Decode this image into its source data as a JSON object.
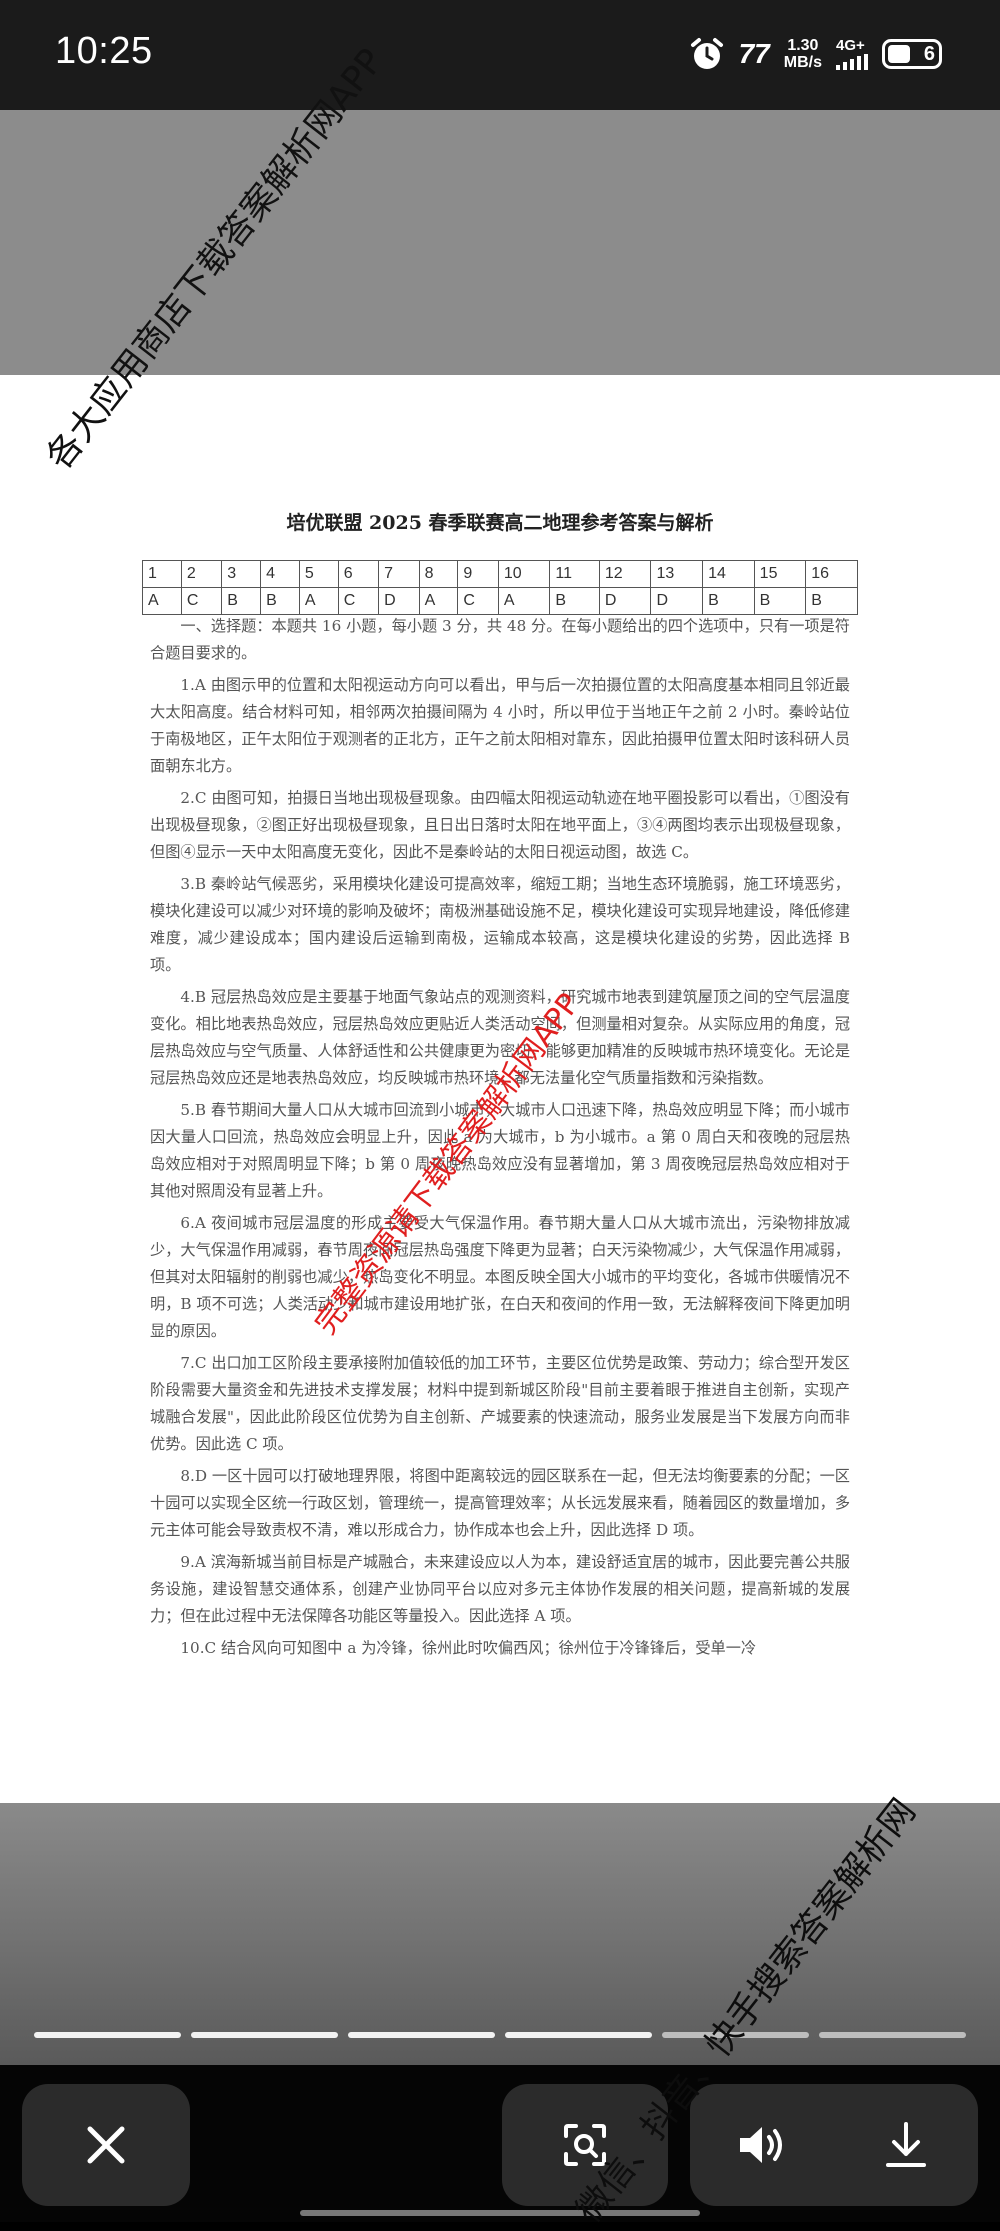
{
  "status_bar": {
    "time": "10:25",
    "hd_label": "77",
    "speed_value": "1.30",
    "speed_unit": "MB/s",
    "network": "4G+",
    "battery_level": "6"
  },
  "document": {
    "title": "培优联盟 2025 春季联赛高二地理参考答案与解析",
    "answer_table": {
      "numbers": [
        "1",
        "2",
        "3",
        "4",
        "5",
        "6",
        "7",
        "8",
        "9",
        "10",
        "11",
        "12",
        "13",
        "14",
        "15",
        "16"
      ],
      "answers": [
        "A",
        "C",
        "B",
        "B",
        "A",
        "C",
        "D",
        "A",
        "C",
        "A",
        "B",
        "D",
        "D",
        "B",
        "B",
        "B"
      ]
    },
    "paragraphs": [
      "一、选择题：本题共 16 小题，每小题 3 分，共 48 分。在每小题给出的四个选项中，只有一项是符合题目要求的。",
      "1.A 由图示甲的位置和太阳视运动方向可以看出，甲与后一次拍摄位置的太阳高度基本相同且邻近最大太阳高度。结合材料可知，相邻两次拍摄间隔为 4 小时，所以甲位于当地正午之前 2 小时。秦岭站位于南极地区，正午太阳位于观测者的正北方，正午之前太阳相对靠东，因此拍摄甲位置太阳时该科研人员面朝东北方。",
      "2.C 由图可知，拍摄日当地出现极昼现象。由四幅太阳视运动轨迹在地平圈投影可以看出，①图没有出现极昼现象，②图正好出现极昼现象，且日出日落时太阳在地平面上，③④两图均表示出现极昼现象，但图④显示一天中太阳高度无变化，因此不是秦岭站的太阳日视运动图，故选 C。",
      "3.B 秦岭站气候恶劣，采用模块化建设可提高效率，缩短工期；当地生态环境脆弱，施工环境恶劣，模块化建设可以减少对环境的影响及破坏；南极洲基础设施不足，模块化建设可实现异地建设，降低修建难度，减少建设成本；国内建设后运输到南极，运输成本较高，这是模块化建设的劣势，因此选择 B 项。",
      "4.B 冠层热岛效应是主要基于地面气象站点的观测资料，研究城市地表到建筑屋顶之间的空气层温度变化。相比地表热岛效应，冠层热岛效应更贴近人类活动空间，但测量相对复杂。从实际应用的角度，冠层热岛效应与空气质量、人体舒适性和公共健康更为密切，能够更加精准的反映城市热环境变化。无论是冠层热岛效应还是地表热岛效应，均反映城市热环境，都无法量化空气质量指数和污染指数。",
      "5.B 春节期间大量人口从大城市回流到小城市，大城市人口迅速下降，热岛效应明显下降；而小城市因大量人口回流，热岛效应会明显上升，因此 a 为大城市，b 为小城市。a 第 0 周白天和夜晚的冠层热岛效应相对于对照周明显下降；b 第 0 周夜晚热岛效应没有显著增加，第 3 周夜晚冠层热岛效应相对于其他对照周没有显著上升。",
      "6.A 夜间城市冠层温度的形成主要受大气保温作用。春节期大量人口从大城市流出，污染物排放减少，大气保温作用减弱，春节周夜间冠层热岛强度下降更为显著；白天污染物减少，大气保温作用减弱，但其对太阳辐射的削弱也减少，热岛变化不明显。本图反映全国大小城市的平均变化，各城市供暖情况不明，B 项不可选；人类活动少和城市建设用地扩张，在白天和夜间的作用一致，无法解释夜间下降更加明显的原因。",
      "7.C 出口加工区阶段主要承接附加值较低的加工环节，主要区位优势是政策、劳动力；综合型开发区阶段需要大量资金和先进技术支撑发展；材料中提到新城区阶段\"目前主要着眼于推进自主创新，实现产城融合发展\"，因此此阶段区位优势为自主创新、产城要素的快速流动，服务业发展是当下发展方向而非优势。因此选 C 项。",
      "8.D 一区十园可以打破地理界限，将图中距离较远的园区联系在一起，但无法均衡要素的分配；一区十园可以实现全区统一行政区划，管理统一，提高管理效率；从长远发展来看，随着园区的数量增加，多元主体可能会导致责权不清，难以形成合力，协作成本也会上升，因此选择 D 项。",
      "9.A 滨海新城当前目标是产城融合，未来建设应以人为本，建设舒适宜居的城市，因此要完善公共服务设施，建设智慧交通体系，创建产业协同平台以应对多元主体协作发展的相关问题，提高新城的发展力；但在此过程中无法保障各功能区等量投入。因此选择 A 项。",
      "10.C 结合风向可知图中 a 为冷锋，徐州此时吹偏西风；徐州位于冷锋锋后，受单一冷"
    ]
  },
  "watermarks": {
    "top": "各大应用商店下载答案解析网APP",
    "middle": "完整资源请下载答案解析网APP",
    "bottom": "微信、抖音、快手搜索答案解析网"
  },
  "viewer": {
    "progress_segments": 6,
    "active_segment": 4
  }
}
